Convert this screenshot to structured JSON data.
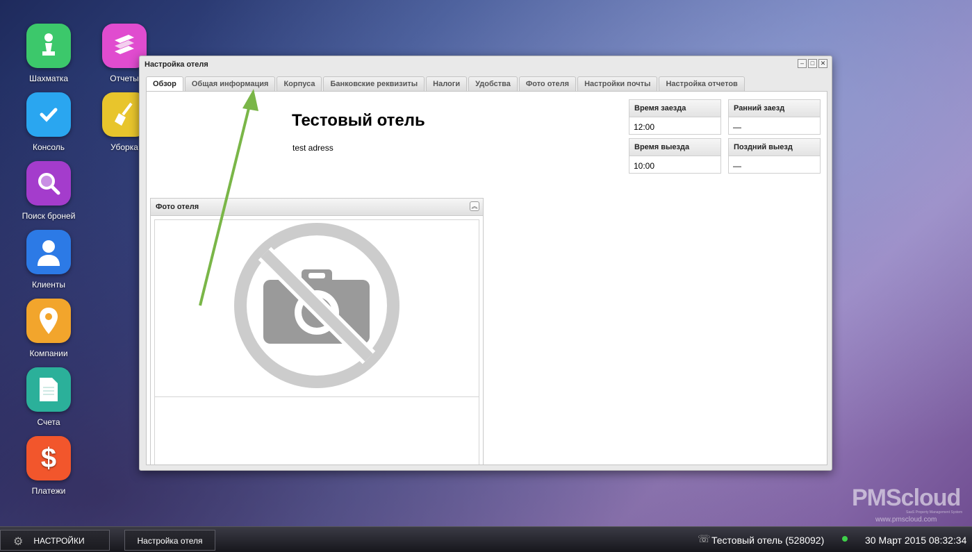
{
  "desktop": {
    "icons": [
      {
        "label": "Шахматка",
        "color": "#3cc86b",
        "icon": "chess-pawn-icon"
      },
      {
        "label": "Отчеты",
        "color": "#e04ccf",
        "icon": "books-icon"
      },
      {
        "label": "Консоль",
        "color": "#2aa6f0",
        "icon": "checkmark-icon"
      },
      {
        "label": "Уборка",
        "color": "#e8c52c",
        "icon": "broom-icon"
      },
      {
        "label": "Поиск броней",
        "color": "#a43ccc",
        "icon": "magnifier-icon"
      },
      {
        "label": "Клиенты",
        "color": "#2c7ae6",
        "icon": "person-icon"
      },
      {
        "label": "Компании",
        "color": "#f2a52c",
        "icon": "map-pin-icon"
      },
      {
        "label": "Счета",
        "color": "#2bb09a",
        "icon": "document-icon"
      },
      {
        "label": "Платежи",
        "color": "#f2562c",
        "icon": "dollar-icon"
      }
    ]
  },
  "window": {
    "title": "Настройка отеля",
    "controls": {
      "minimize": "–",
      "maximize": "□",
      "close": "✕"
    },
    "tabs": [
      {
        "label": "Обзор",
        "active": true
      },
      {
        "label": "Общая информация",
        "active": false
      },
      {
        "label": "Корпуса",
        "active": false
      },
      {
        "label": "Банковские реквизиты",
        "active": false
      },
      {
        "label": "Налоги",
        "active": false
      },
      {
        "label": "Удобства",
        "active": false
      },
      {
        "label": "Фото отеля",
        "active": false
      },
      {
        "label": "Настройки почты",
        "active": false
      },
      {
        "label": "Настройка отчетов",
        "active": false
      }
    ],
    "overview": {
      "hotel_name": "Тестовый отель",
      "address": "test adress",
      "checkin_label": "Время заезда",
      "checkin_value": "12:00",
      "early_checkin_label": "Ранний заезд",
      "early_checkin_value": "—",
      "checkout_label": "Время выезда",
      "checkout_value": "10:00",
      "late_checkout_label": "Поздний выезд",
      "late_checkout_value": "—",
      "photo_panel_title": "Фото отеля",
      "photo_placeholder_icon": "no-camera-icon"
    }
  },
  "annotation": {
    "arrow_color": "#7ab648"
  },
  "taskbar": {
    "settings_label": "НАСТРОЙКИ",
    "window_button_label": "Настройка отеля",
    "hotel_status": "Тестовый отель (528092)",
    "datetime": "30 Март 2015 08:32:34",
    "status_color": "#3fd14a"
  },
  "brand": {
    "logo_text": "PMScloud",
    "tagline": "SaaS Property Management System",
    "url": "www.pmscloud.com"
  }
}
